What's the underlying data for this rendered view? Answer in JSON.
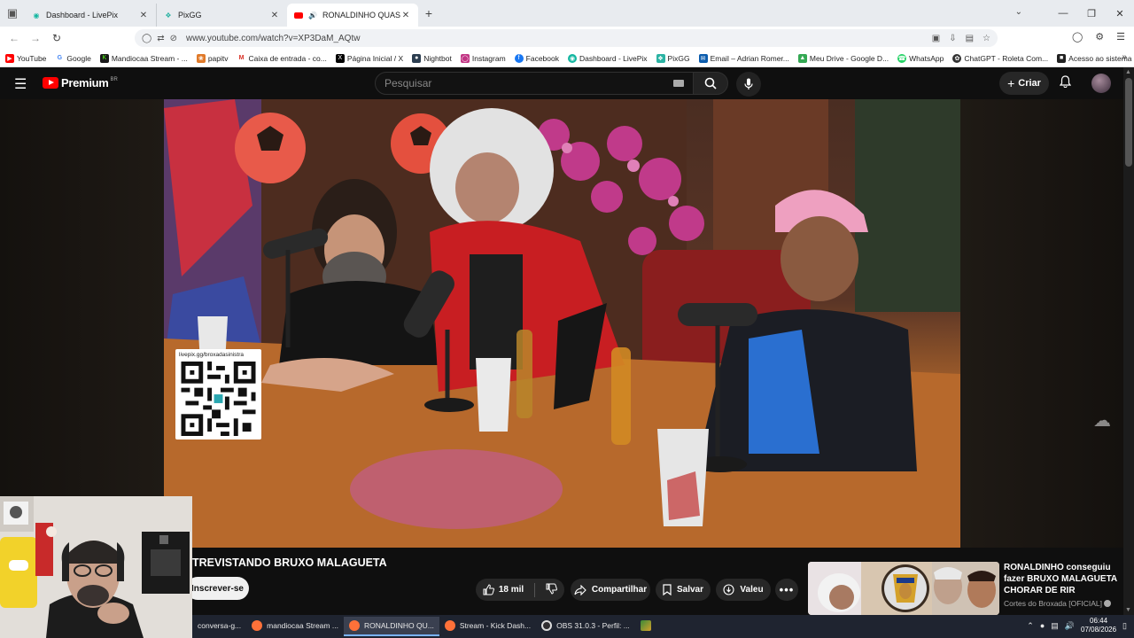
{
  "browser": {
    "tabs": [
      {
        "label": "Dashboard - LivePix",
        "icon": "livepix-icon",
        "active": false
      },
      {
        "label": "PixGG",
        "icon": "pixgg-icon",
        "active": false
      },
      {
        "label": "RONALDINHO QUASE APAG",
        "icon": "youtube-icon",
        "active": true
      }
    ],
    "url": "www.youtube.com/watch?v=XP3DaM_AQtw",
    "bookmarks": [
      {
        "label": "YouTube",
        "color": "#ff0000"
      },
      {
        "label": "Google",
        "color": "#4285f4"
      },
      {
        "label": "Mandiocaa Stream - ...",
        "color": "#1a1a1a"
      },
      {
        "label": "papitv",
        "color": "#e07a2a"
      },
      {
        "label": "Caixa de entrada - co...",
        "color": "#d93025"
      },
      {
        "label": "Página Inicial / X",
        "color": "#000000"
      },
      {
        "label": "Nightbot",
        "color": "#2c3e50"
      },
      {
        "label": "Instagram",
        "color": "#c13584"
      },
      {
        "label": "Facebook",
        "color": "#1877f2"
      },
      {
        "label": "Dashboard - LivePix",
        "color": "#13b6a0"
      },
      {
        "label": "PixGG",
        "color": "#2bb3a3"
      },
      {
        "label": "Email – Adrian Romer...",
        "color": "#0b5cad"
      },
      {
        "label": "Meu Drive - Google D...",
        "color": "#34a853"
      },
      {
        "label": "WhatsApp",
        "color": "#25d366"
      },
      {
        "label": "ChatGPT - Roleta Com...",
        "color": "#333333"
      },
      {
        "label": "Acesso ao sistema - Si...",
        "color": "#222222"
      }
    ]
  },
  "youtube": {
    "logo_text": "Premium",
    "country": "BR",
    "search_placeholder": "Pesquisar",
    "create_label": "Criar",
    "qr_text": "livepix.gg/broxadasinistra",
    "video_title": "TREVISTANDO BRUXO MALAGUETA",
    "subscribe_label": "Inscrever-se",
    "likes": "18 mil",
    "share_label": "Compartilhar",
    "save_label": "Salvar",
    "thanks_label": "Valeu",
    "recommendation": {
      "title": "RONALDINHO conseguiu fazer BRUXO MALAGUETA CHORAR DE RIR",
      "channel": "Cortes do Broxada [OFICIAL]"
    }
  },
  "taskbar": {
    "tasks": [
      {
        "label": "conversa-g...",
        "color": "#444444",
        "active": false
      },
      {
        "label": "mandiocaa Stream ...",
        "color": "#ff7139",
        "active": false
      },
      {
        "label": "RONALDINHO QU...",
        "color": "#ff7139",
        "active": true
      },
      {
        "label": "Stream - Kick Dash...",
        "color": "#ff7139",
        "active": false
      },
      {
        "label": "OBS 31.0.3 - Perfil: ...",
        "color": "#302e31",
        "active": false
      }
    ],
    "time": "06:44",
    "date": "07/08/2026"
  }
}
